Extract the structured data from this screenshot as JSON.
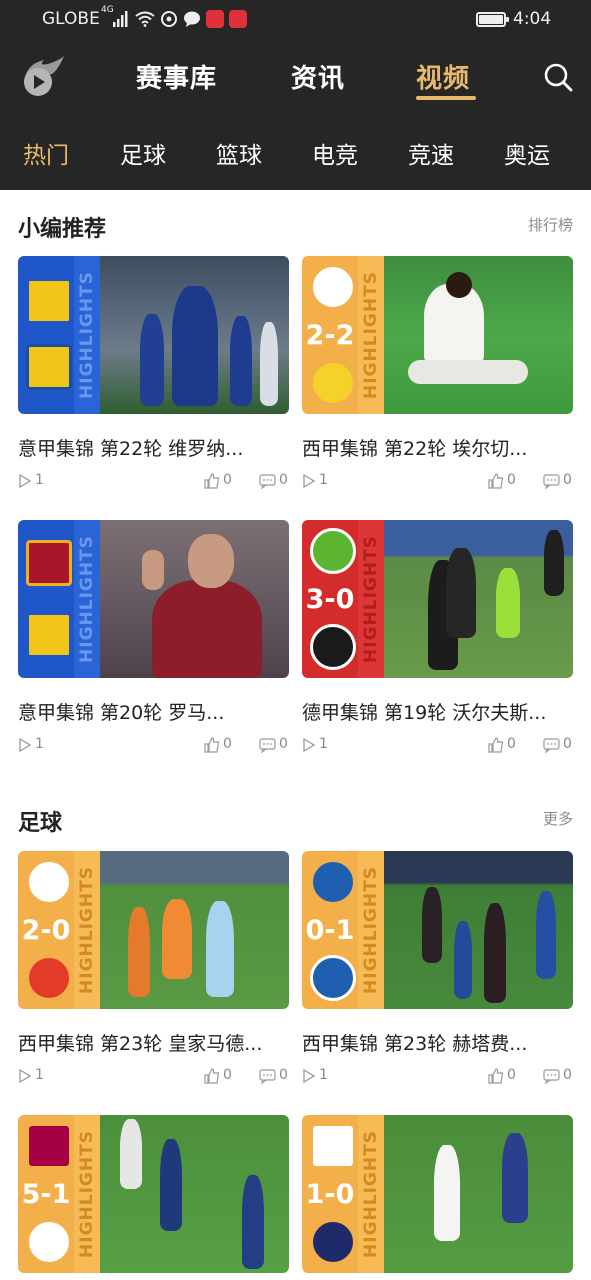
{
  "status_bar": {
    "carrier": "GLOBE",
    "network": "4G",
    "time": "4:04"
  },
  "nav": {
    "tabs": [
      "赛事库",
      "资讯",
      "视频"
    ],
    "active_tab": "视频",
    "search_icon": "search-icon",
    "logo_icon": "flaming-ball-logo"
  },
  "categories": [
    "热门",
    "足球",
    "篮球",
    "电竞",
    "竞速",
    "奥运"
  ],
  "active_category": "热门",
  "sections": [
    {
      "title": "小编推荐",
      "more": "排行榜",
      "videos": [
        {
          "title": "意甲集锦 第22轮 维罗纳...",
          "plays": "1",
          "likes": "0",
          "comments": "0",
          "score": "",
          "highlight": "HIGHLIGHTS"
        },
        {
          "title": "西甲集锦 第22轮 埃尔切...",
          "plays": "1",
          "likes": "0",
          "comments": "0",
          "score": "2-2",
          "highlight": "HIGHLIGHTS"
        },
        {
          "title": "意甲集锦 第20轮 罗马...",
          "plays": "1",
          "likes": "0",
          "comments": "0",
          "score": "",
          "highlight": "HIGHLIGHTS"
        },
        {
          "title": "德甲集锦 第19轮 沃尔夫斯...",
          "plays": "1",
          "likes": "0",
          "comments": "0",
          "score": "3-0",
          "highlight": "HIGHLIGHTS"
        }
      ]
    },
    {
      "title": "足球",
      "more": "更多",
      "videos": [
        {
          "title": "西甲集锦 第23轮 皇家马德...",
          "plays": "1",
          "likes": "0",
          "comments": "0",
          "score": "2-0",
          "highlight": "HIGHLIGHTS"
        },
        {
          "title": "西甲集锦 第23轮 赫塔费...",
          "plays": "1",
          "likes": "0",
          "comments": "0",
          "score": "0-1",
          "highlight": "HIGHLIGHTS"
        },
        {
          "title": "",
          "plays": "",
          "likes": "",
          "comments": "",
          "score": "5-1",
          "highlight": "HIGHLIGHTS"
        },
        {
          "title": "",
          "plays": "",
          "likes": "",
          "comments": "",
          "score": "1-0",
          "highlight": "HIGHLIGHTS"
        }
      ]
    }
  ],
  "colors": {
    "header_bg": "#262626",
    "accent": "#e8b96c",
    "text_primary": "#222222",
    "text_muted": "#8c8c8c",
    "serie_a_panel": "#1f56c8",
    "bundesliga_panel": "#d42b2b",
    "laliga_panel": "#f3b04a"
  }
}
